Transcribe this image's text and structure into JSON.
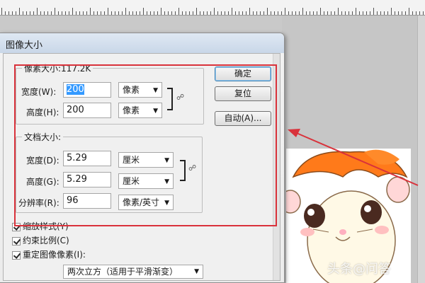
{
  "dialog": {
    "title": "图像大小"
  },
  "pixel_dims": {
    "legend": "像素大小:117.2K",
    "width_label": "宽度(W):",
    "width_value": "200",
    "width_unit": "像素",
    "height_label": "高度(H):",
    "height_value": "200",
    "height_unit": "像素"
  },
  "doc_size": {
    "legend": "文档大小:",
    "width_label": "宽度(D):",
    "width_value": "5.29",
    "width_unit": "厘米",
    "height_label": "高度(G):",
    "height_value": "5.29",
    "height_unit": "厘米",
    "res_label": "分辨率(R):",
    "res_value": "96",
    "res_unit": "像素/英寸"
  },
  "buttons": {
    "ok": "确定",
    "reset": "复位",
    "auto": "自动(A)..."
  },
  "options": {
    "scale_styles": "缩放样式(Y)",
    "constrain": "约束比例(C)",
    "resample": "重定图像像素(I):",
    "resample_method": "两次立方（适用于平滑渐变）"
  },
  "icons": {
    "link": "chain-link-icon",
    "dropdown": "chevron-down-icon"
  },
  "colors": {
    "highlight": "#d9323b",
    "accent": "#3399ff"
  },
  "watermark": "头条@问答"
}
